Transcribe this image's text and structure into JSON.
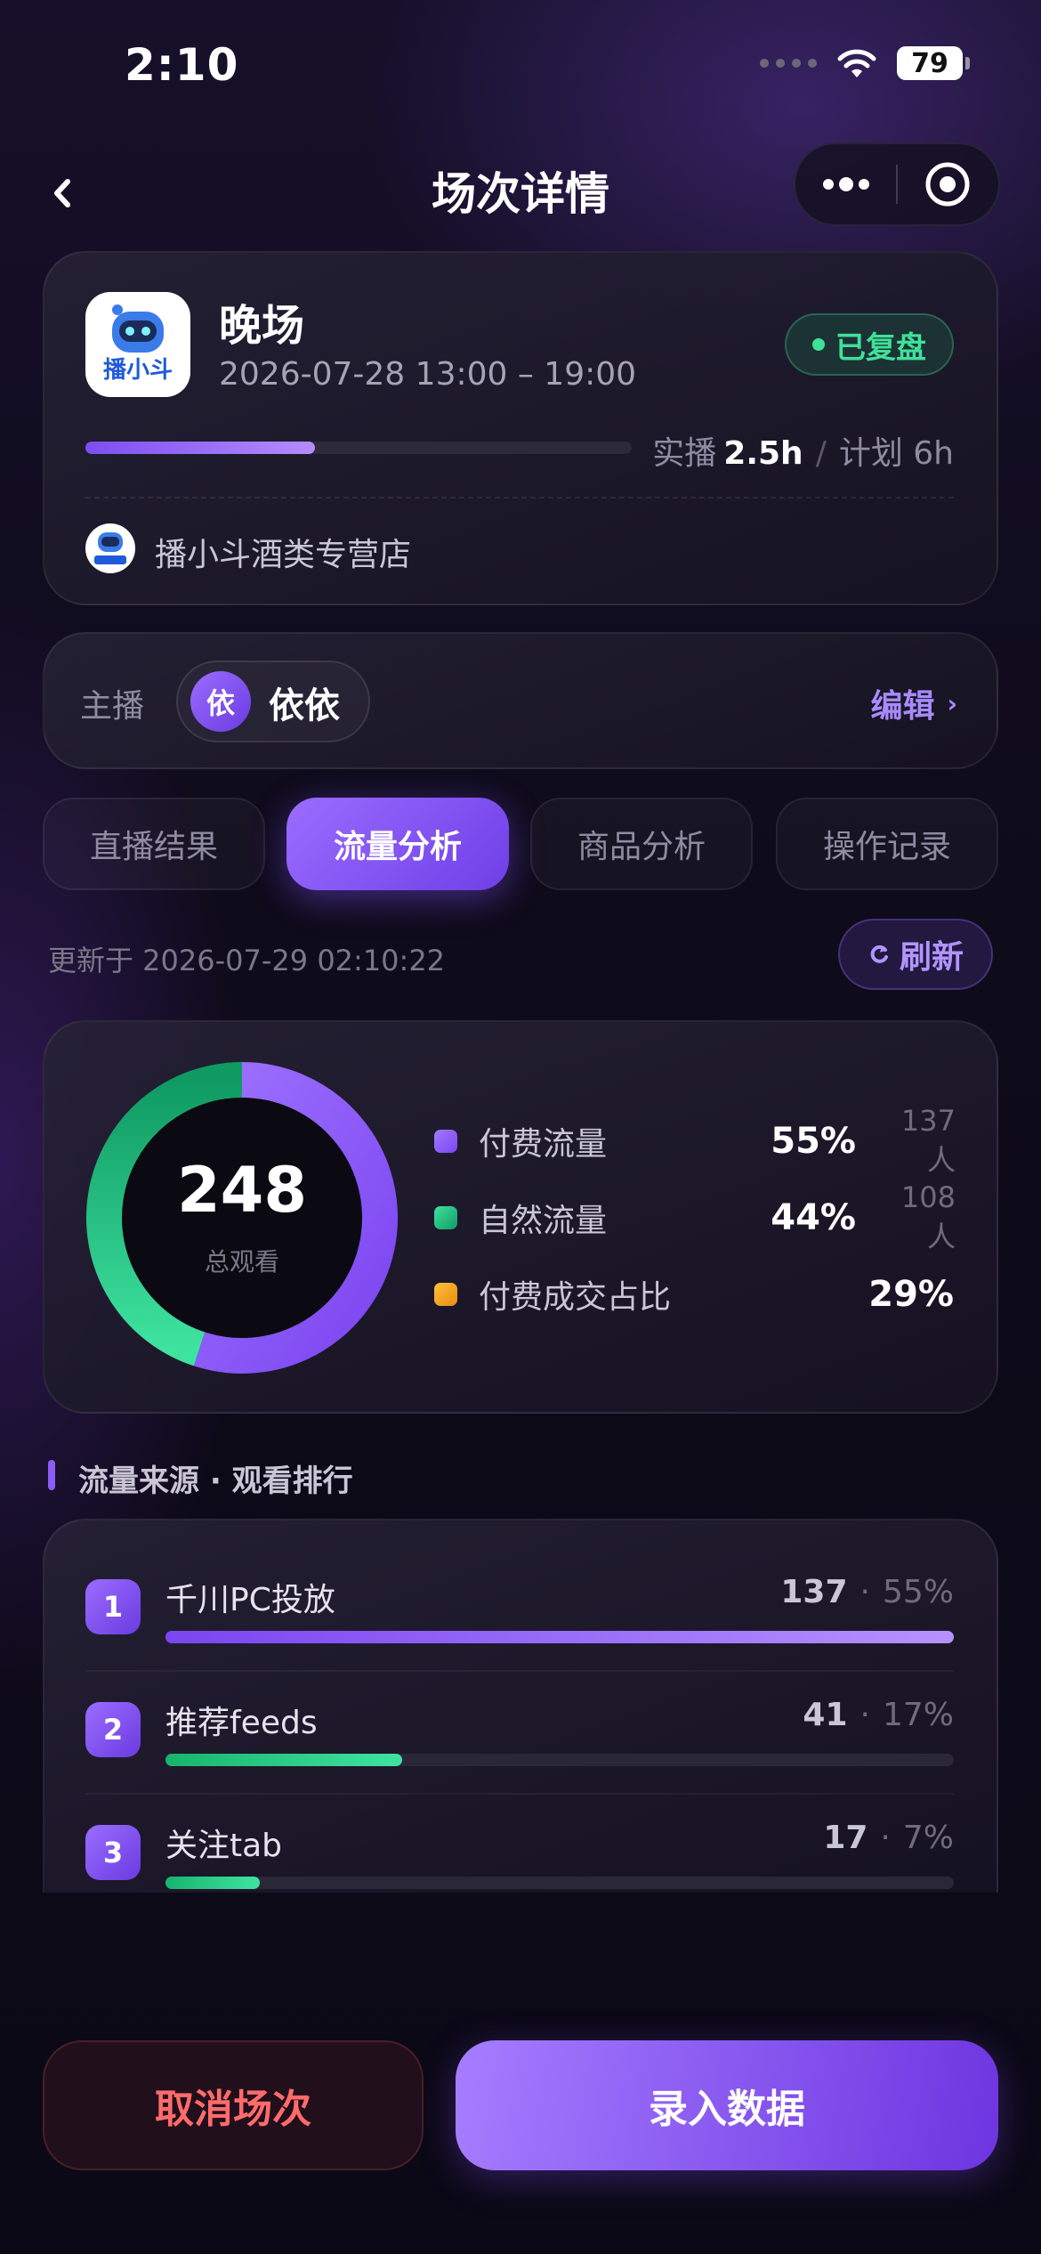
{
  "status_bar": {
    "time": "2:10",
    "battery": "79"
  },
  "nav": {
    "title": "场次详情"
  },
  "session": {
    "logo_text": "播小斗",
    "title": "晚场",
    "time_range": "2026-07-28 13:00 – 19:00",
    "badge": "已复盘",
    "progress_fraction": 0.42,
    "actual_label": "实播",
    "actual_value": "2.5h",
    "separator": "/",
    "plan_label": "计划 6h",
    "store_name": "播小斗酒类专营店"
  },
  "anchor": {
    "label": "主播",
    "avatar_char": "依",
    "name": "依依",
    "edit_label": "编辑"
  },
  "tabs": [
    {
      "label": "直播结果",
      "active": false
    },
    {
      "label": "流量分析",
      "active": true
    },
    {
      "label": "商品分析",
      "active": false
    },
    {
      "label": "操作记录",
      "active": false
    }
  ],
  "updated": {
    "text": "更新于 2026-07-29 02:10:22",
    "refresh_label": "刷新"
  },
  "donut": {
    "total": "248",
    "total_label": "总观看",
    "paid_fraction": 0.55,
    "colors": {
      "paid": "#8b5cf6",
      "natural": "#2fd08a"
    },
    "legend": [
      {
        "name": "付费流量",
        "pct": "55%",
        "count": "137 人",
        "color": "#8b5cf6"
      },
      {
        "name": "自然流量",
        "pct": "44%",
        "count": "108 人",
        "color": "#22c07e"
      },
      {
        "name": "付费成交占比",
        "pct": "29%",
        "count": "",
        "color": "#f5a524"
      }
    ]
  },
  "section": {
    "title": "流量来源 · 观看排行"
  },
  "ranking": [
    {
      "rank": "1",
      "name": "千川PC投放",
      "value": "137",
      "pct": "55%",
      "fraction": 1.0,
      "color": "purple"
    },
    {
      "rank": "2",
      "name": "推荐feeds",
      "value": "41",
      "pct": "17%",
      "fraction": 0.3,
      "color": "green"
    },
    {
      "rank": "3",
      "name": "关注tab",
      "value": "17",
      "pct": "7%",
      "fraction": 0.12,
      "color": "green"
    }
  ],
  "actions": {
    "cancel": "取消场次",
    "enter": "录入数据"
  }
}
